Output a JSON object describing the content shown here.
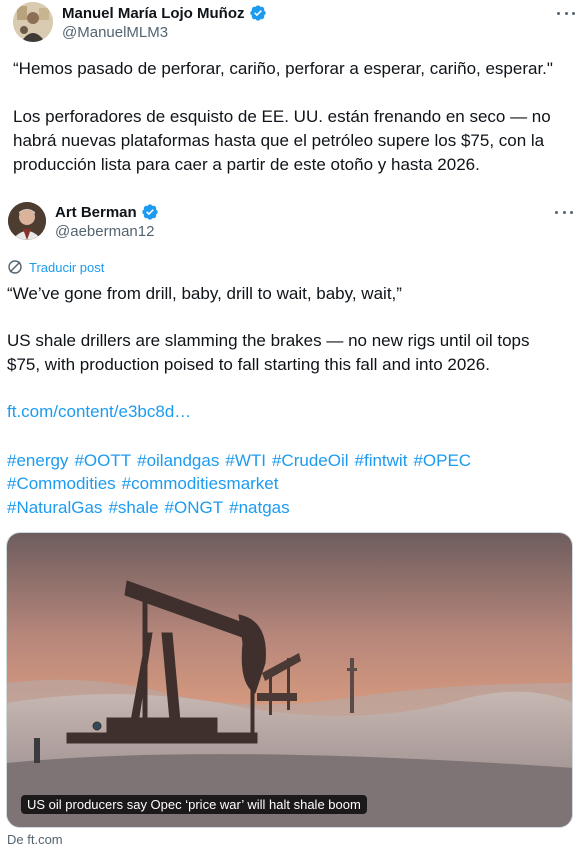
{
  "author": {
    "name": "Manuel María Lojo Muñoz",
    "handle": "@ManuelMLM3"
  },
  "post_text": {
    "line1": "“Hemos pasado de perforar, cariño, perforar a esperar, cariño, esperar.\"",
    "line2": "Los perforadores de esquisto de EE. UU. están frenando en seco — no",
    "line3": "habrá nuevas plataformas hasta que el petróleo supere los $75, con la",
    "line4": "producción lista para caer a partir de este otoño y hasta 2026."
  },
  "quoted": {
    "name": "Art Berman",
    "handle": "@aeberman12",
    "translate_label": "Traducir post",
    "line1": "“We’ve gone from drill, baby, drill to wait, baby, wait,”",
    "line2": "US shale drillers are slamming the brakes — no new rigs until oil tops",
    "line3": "$75, with production poised to fall starting this fall and into 2026.",
    "link": "ft.com/content/e3bc8d…",
    "hashtags_line1": [
      "#energy",
      "#OOTT",
      "#oilandgas",
      "#WTI",
      "#CrudeOil",
      "#fintwit",
      "#OPEC"
    ],
    "hashtags_line2": [
      "#Commodities",
      "#commoditiesmarket"
    ],
    "hashtags_line3": [
      "#NaturalGas",
      "#shale",
      "#ONGT",
      "#natgas"
    ]
  },
  "card": {
    "caption": "US oil producers say Opec ‘price war’ will halt shale boom",
    "source": "De ft.com"
  },
  "icons": {
    "verified": "verified-badge-icon",
    "more": "more-options-icon",
    "translate": "translate-icon"
  },
  "colors": {
    "link": "#1d9bf0",
    "text": "#0f1419",
    "muted": "#536471"
  }
}
